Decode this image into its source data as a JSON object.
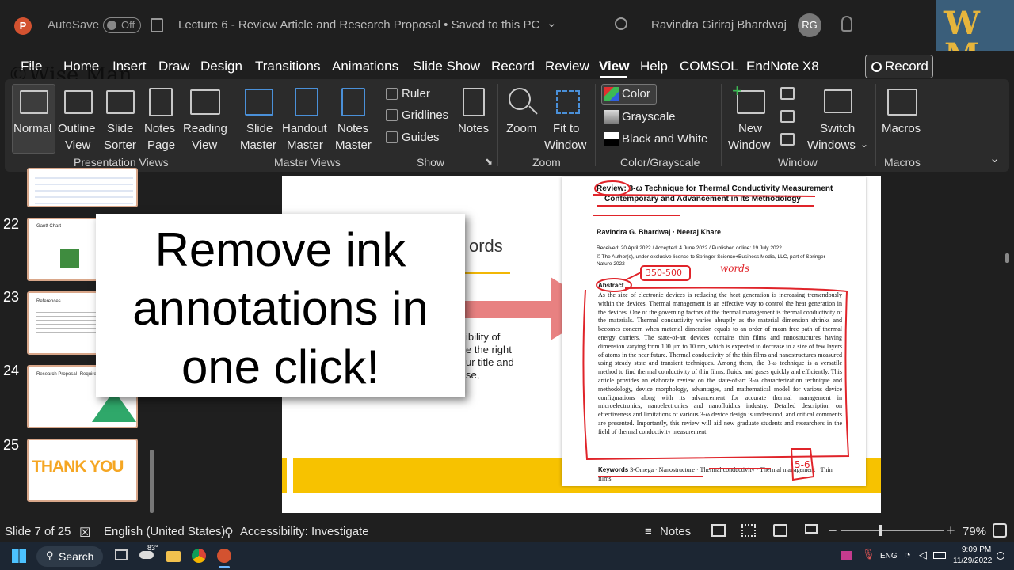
{
  "titlebar": {
    "autosave_label": "AutoSave",
    "autosave_state": "Off",
    "doc_title": "Lecture 6 - Review Article and Research Proposal • Saved to this PC",
    "user_name": "Ravindra Giriraj Bhardwaj",
    "user_initials": "RG",
    "watermark_logo_text": "WM",
    "watermark_text": "©Wise Man"
  },
  "tabs": [
    "File",
    "Home",
    "Insert",
    "Draw",
    "Design",
    "Transitions",
    "Animations",
    "Slide Show",
    "Record",
    "Review",
    "View",
    "Help",
    "COMSOL",
    "EndNote X8"
  ],
  "record_button": "Record",
  "ribbon": {
    "presentation_views": {
      "label": "Presentation Views",
      "items": [
        {
          "l1": "Normal",
          "l2": ""
        },
        {
          "l1": "Outline",
          "l2": "View"
        },
        {
          "l1": "Slide",
          "l2": "Sorter"
        },
        {
          "l1": "Notes",
          "l2": "Page"
        },
        {
          "l1": "Reading",
          "l2": "View"
        }
      ]
    },
    "master_views": {
      "label": "Master Views",
      "items": [
        {
          "l1": "Slide",
          "l2": "Master"
        },
        {
          "l1": "Handout",
          "l2": "Master"
        },
        {
          "l1": "Notes",
          "l2": "Master"
        }
      ]
    },
    "show": {
      "label": "Show",
      "ruler": "Ruler",
      "gridlines": "Gridlines",
      "guides": "Guides",
      "notes": "Notes"
    },
    "zoom": {
      "label": "Zoom",
      "zoom": "Zoom",
      "fit_l1": "Fit to",
      "fit_l2": "Window"
    },
    "color": {
      "label": "Color/Grayscale",
      "color": "Color",
      "grayscale": "Grayscale",
      "bw": "Black and White"
    },
    "window": {
      "label": "Window",
      "new_l1": "New",
      "new_l2": "Window",
      "switch_l1": "Switch",
      "switch_l2": "Windows"
    },
    "macros": {
      "label": "Macros",
      "macros": "Macros"
    }
  },
  "slides": {
    "numbers": [
      "22",
      "23",
      "24",
      "25"
    ],
    "thumb22_title": "Gantt Chart",
    "thumb23_title": "References",
    "thumb24_title": "Research Proposal- Requireme",
    "thumb25_text": "THANK YOU"
  },
  "slide": {
    "heading_fragment": "ords",
    "body_fragments": [
      "ibility of",
      "e the right",
      "ur title and",
      "se,"
    ]
  },
  "paper": {
    "review_word": "Review:",
    "title": "3-ω Technique for Thermal Conductivity Measurement—Contemporary and Advancement in Its Methodology",
    "authors": "Ravindra G. Bhardwaj · Neeraj Khare",
    "received": "Received: 20 April 2022 / Accepted: 4 June 2022 / Published online: 19 July 2022",
    "copyright": "© The Author(s), under exclusive licence to Springer Science+Business Media, LLC, part of Springer Nature 2022",
    "abstract_label": "Abstract",
    "abstract": "As the size of electronic devices is reducing the heat generation is increasing tremendously within the devices. Thermal management is an effective way to control the heat generation in the devices. One of the governing factors of the thermal management is thermal conductivity of the materials. Thermal conductivity varies abruptly as the material dimension shrinks and becomes concern when material dimension equals to an order of mean free path of thermal energy carriers. The state-of-art devices contains thin films and nanostructures having dimension varying from 100 μm to 10 nm, which is expected to decrease to a size of few layers of atoms in the near future. Thermal conductivity of the thin films and nanostructures measured using steady state and transient techniques. Among them, the 3-ω technique is a versatile method to find thermal conductivity of thin films, fluids, and gases quickly and efficiently. This article provides an elaborate review on the state-of-art 3-ω characterization technique and methodology, device morphology, advantages, and mathematical model for various device configurations along with its advancement for accurate thermal management in microelectronics, nanoelectronics and nanofluidics industry. Detailed description on effectiveness and limitations of various 3-ω device design is understood, and critical comments are presented. Importantly, this review will aid new graduate students and researchers in the field of thermal conductivity measurement.",
    "keywords_label": "Keywords",
    "keywords": "3-Omega · Nanostructure · Thermal conductivity · Thermal management · Thin films",
    "ink_350": "350-500",
    "ink_words": "words",
    "ink_56": "5-6"
  },
  "callout": {
    "line1": "Remove ink",
    "line2": "annotations in",
    "line3": "one click!"
  },
  "status": {
    "slide_of": "Slide 7 of 25",
    "language": "English (United States)",
    "accessibility": "Accessibility: Investigate",
    "notes": "Notes",
    "zoom": "79%"
  },
  "taskbar": {
    "search": "Search",
    "temp": "83°",
    "lang": "ENG",
    "time": "9:09 PM",
    "date": "11/29/2022"
  }
}
